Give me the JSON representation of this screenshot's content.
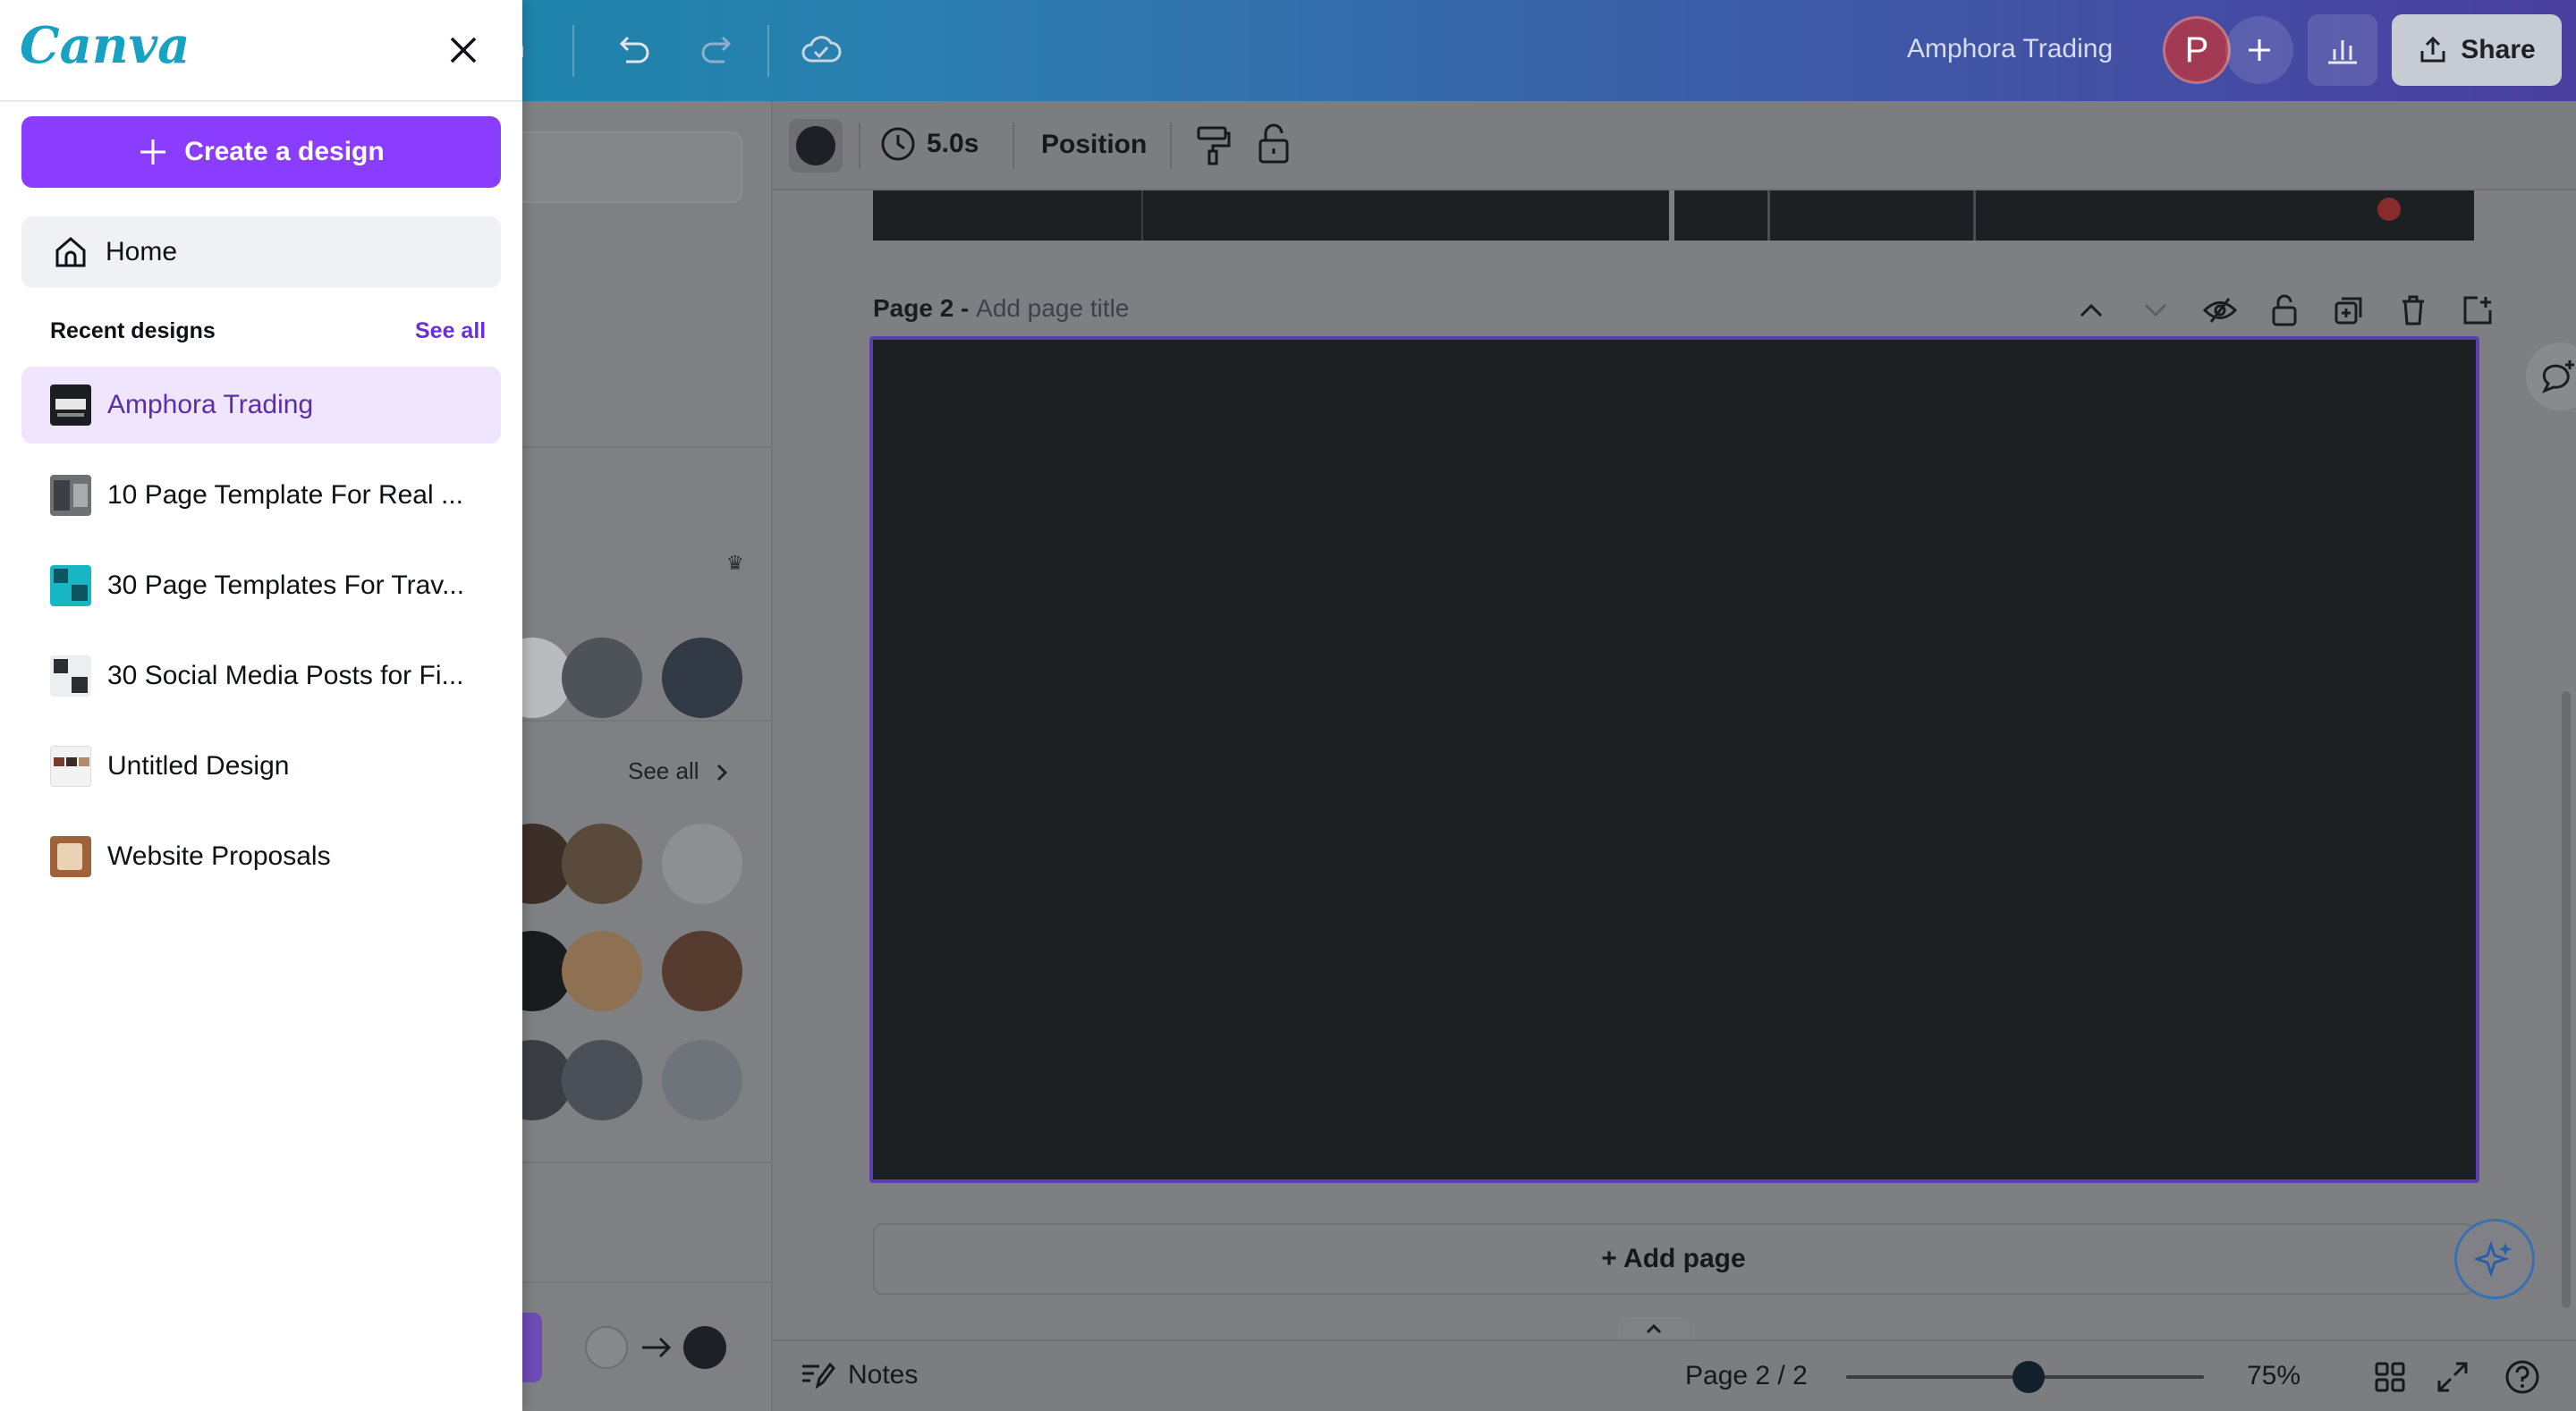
{
  "topbar": {
    "partial_text": "h",
    "doc_title": "Amphora Trading",
    "avatar_letter": "P",
    "share_label": "Share"
  },
  "context_toolbar": {
    "duration": "5.0s",
    "position_label": "Position"
  },
  "side_panel": {
    "see_all": "See all",
    "swatches_row1": [
      "#b9bbbf",
      "#4e5358",
      "#323a45"
    ],
    "swatches_row2": [
      "#3b2f28",
      "#5a4a3b",
      "#8c9092"
    ],
    "swatches_row3": [
      "#1a1b1d",
      "#8e7052",
      "#563c2e"
    ],
    "swatches_row4": [
      "#3a3d44",
      "#4b4f57",
      "#6f747b"
    ]
  },
  "canvas": {
    "page_label": "Page 2 - ",
    "page_title_placeholder": "Add page title",
    "add_page_label": "+ Add page",
    "page_fill": "#1c1f22",
    "selection_color": "#5b3fb0"
  },
  "bottombar": {
    "notes_label": "Notes",
    "page_indicator": "Page 2 / 2",
    "zoom_level": "75%"
  },
  "drawer": {
    "logo": "Canva",
    "create_label": "Create a design",
    "home_label": "Home",
    "recent_title": "Recent designs",
    "recent_see_all": "See all",
    "recent_items": [
      {
        "label": "Amphora Trading",
        "active": true
      },
      {
        "label": "10 Page Template For Real ...",
        "active": false
      },
      {
        "label": "30 Page Templates For Trav...",
        "active": false
      },
      {
        "label": "30 Social Media Posts for Fi...",
        "active": false
      },
      {
        "label": "Untitled Design",
        "active": false
      },
      {
        "label": "Website Proposals",
        "active": false
      }
    ],
    "accent": "#8b3dff"
  }
}
